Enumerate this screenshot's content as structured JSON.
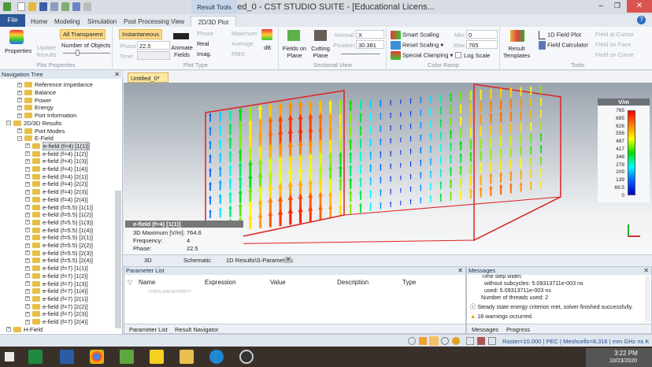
{
  "window": {
    "title": "Untitled_0 - CST STUDIO SUITE - [Educational Licens...",
    "context_tab": "Result Tools"
  },
  "tabs": [
    "File",
    "Home",
    "Modeling",
    "Simulation",
    "Post Processing",
    "View",
    "2D/3D Plot"
  ],
  "ribbon": {
    "plot_properties": {
      "properties": "Properties",
      "update_results": "Update Results",
      "all_transparent": "All Transparent",
      "number_of_objects": "Number of Objects",
      "label": "Plot Properties"
    },
    "plot_type": {
      "instantaneous": "Instantaneous",
      "phase_label": "Phase:",
      "phase_value": "22.5",
      "time_label": "Time:",
      "animate": "Animate Fields",
      "phase": "Phase",
      "real": "Real",
      "imag": "Imag.",
      "maximum": "Maximum",
      "average": "Average",
      "rms": "RMS",
      "db": "dB",
      "label": "Plot Type"
    },
    "sectional_view": {
      "fields_on_plane": "Fields on Plane",
      "cutting_plane": "Cutting Plane",
      "normal_label": "Normal:",
      "normal_value": "X",
      "position_label": "Position:",
      "position_value": "30.381",
      "label": "Sectional View"
    },
    "color_ramp": {
      "smart_scaling": "Smart Scaling",
      "reset_scaling": "Reset Scaling",
      "special_clamping": "Special Clamping",
      "min_label": "Min:",
      "min_value": "0",
      "max_label": "Max:",
      "max_value": "765",
      "log_scale": "Log Scale",
      "label": "Color Ramp"
    },
    "tools": {
      "result_templates": "Result Templates",
      "field_plot_1d": "1D Field Plot",
      "field_calculator": "Field Calculator",
      "field_at_cursor": "Field at Cursor",
      "field_on_face": "Field on Face",
      "field_on_curve": "Field on Curve",
      "label": "Tools"
    }
  },
  "nav": {
    "title": "Navigation Tree",
    "items": [
      {
        "label": "Reference Impedance",
        "level": 1
      },
      {
        "label": "Balance",
        "level": 1
      },
      {
        "label": "Power",
        "level": 1
      },
      {
        "label": "Energy",
        "level": 1
      },
      {
        "label": "Port Information",
        "level": 1
      },
      {
        "label": "2D/3D Results",
        "level": 0
      },
      {
        "label": "Port Modes",
        "level": 1
      },
      {
        "label": "E-Field",
        "level": 1
      },
      {
        "label": "e-field (f=4) [1(1)]",
        "level": 2,
        "selected": true
      },
      {
        "label": "e-field (f=4) [1(2)]",
        "level": 2
      },
      {
        "label": "e-field (f=4) [1(3)]",
        "level": 2
      },
      {
        "label": "e-field (f=4) [1(4)]",
        "level": 2
      },
      {
        "label": "e-field (f=4) [2(1)]",
        "level": 2
      },
      {
        "label": "e-field (f=4) [2(2)]",
        "level": 2
      },
      {
        "label": "e-field (f=4) [2(3)]",
        "level": 2
      },
      {
        "label": "e-field (f=4) [2(4)]",
        "level": 2
      },
      {
        "label": "e-field (f=5.5) [1(1)]",
        "level": 2
      },
      {
        "label": "e-field (f=5.5) [1(2)]",
        "level": 2
      },
      {
        "label": "e-field (f=5.5) [1(3)]",
        "level": 2
      },
      {
        "label": "e-field (f=5.5) [1(4)]",
        "level": 2
      },
      {
        "label": "e-field (f=5.5) [2(1)]",
        "level": 2
      },
      {
        "label": "e-field (f=5.5) [2(2)]",
        "level": 2
      },
      {
        "label": "e-field (f=5.5) [2(3)]",
        "level": 2
      },
      {
        "label": "e-field (f=5.5) [2(4)]",
        "level": 2
      },
      {
        "label": "e-field (f=7) [1(1)]",
        "level": 2
      },
      {
        "label": "e-field (f=7) [1(2)]",
        "level": 2
      },
      {
        "label": "e-field (f=7) [1(3)]",
        "level": 2
      },
      {
        "label": "e-field (f=7) [1(4)]",
        "level": 2
      },
      {
        "label": "e-field (f=7) [2(1)]",
        "level": 2
      },
      {
        "label": "e-field (f=7) [2(2)]",
        "level": 2
      },
      {
        "label": "e-field (f=7) [2(3)]",
        "level": 2
      },
      {
        "label": "e-field (f=7) [2(4)]",
        "level": 2
      },
      {
        "label": "H-Field",
        "level": 0
      }
    ]
  },
  "view": {
    "doc_tab": "Untitled_0*",
    "info": {
      "title": "e-field (f=4) [1(1)]",
      "max_label": "3D Maximum [V/m]:",
      "max_value": "764.6",
      "freq_label": "Frequency:",
      "freq_value": "4",
      "phase_label": "Phase:",
      "phase_value": "22.5"
    },
    "colorbar": {
      "unit": "V/m",
      "ticks": [
        "765",
        "695",
        "626",
        "556",
        "487",
        "417",
        "348",
        "278",
        "209",
        "139",
        "69.5",
        "0"
      ]
    },
    "bottom_tabs": [
      "3D",
      "Schematic",
      "1D Results\\S-Parameters"
    ]
  },
  "param": {
    "title": "Parameter List",
    "columns": [
      "Name",
      "Expression",
      "Value",
      "Description",
      "Type"
    ],
    "placeholder": "<new parameter>",
    "tabs": [
      "Parameter List",
      "Result Navigator"
    ]
  },
  "messages": {
    "title": "Messages",
    "lines": [
      "Time step width:",
      "without subcycles: 5.09313711e-003 ns",
      "used: 5.09313711e-003 ns",
      "Number of threads used: 2",
      "Steady state energy criterion met, solver finished successfully.",
      "18 warnings occurred."
    ],
    "tabs": [
      "Messages",
      "Progress"
    ]
  },
  "status": {
    "raster": "Raster=10.000",
    "material": "PEC",
    "meshcells": "Meshcells=8,316",
    "units": "mm  GHz  ns  K"
  },
  "taskbar": {
    "time": "3:22 PM",
    "date": "10/23/2020"
  },
  "colors": {
    "file_tab": "#2b5797",
    "highlight": "#fcd98a"
  }
}
